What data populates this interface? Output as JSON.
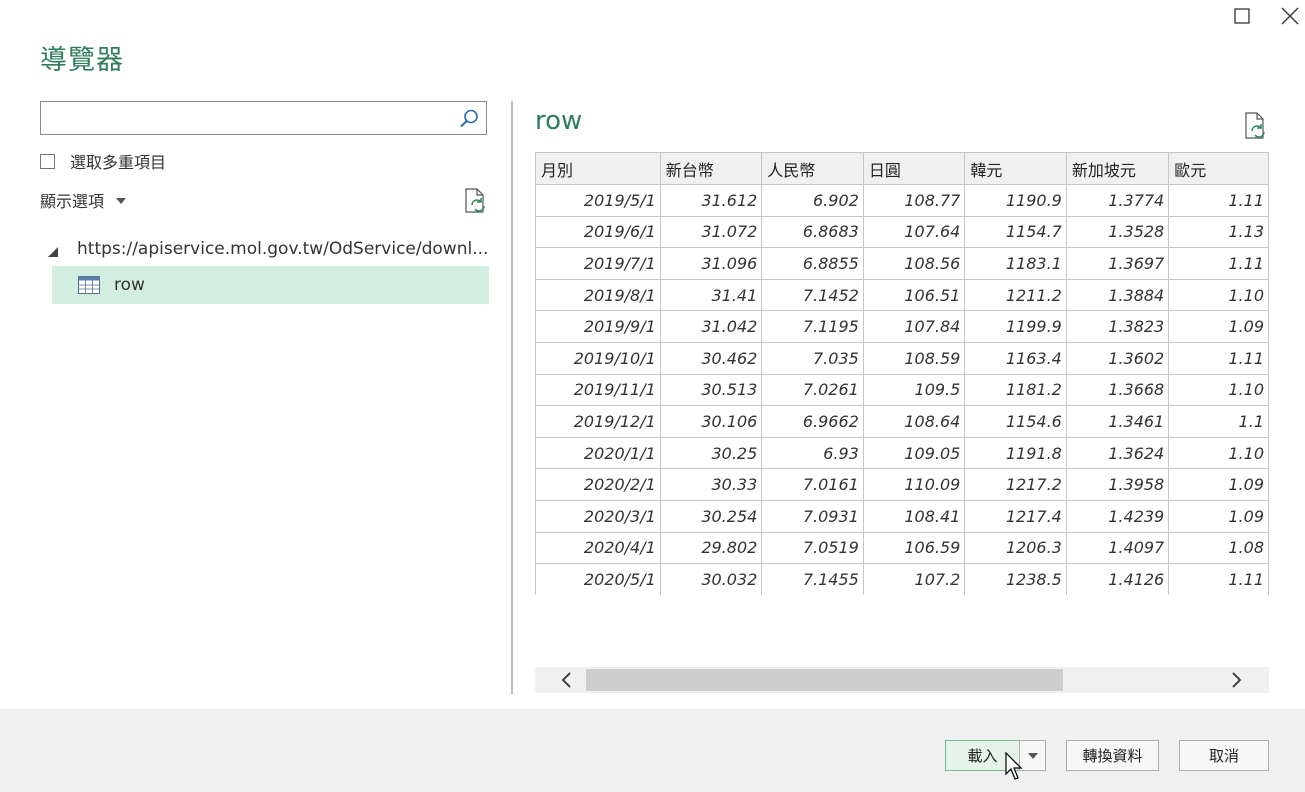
{
  "window": {
    "title": "導覽器",
    "maximize_icon": "maximize-icon",
    "close_icon": "close-icon"
  },
  "navigator": {
    "search": {
      "value": "",
      "placeholder": ""
    },
    "select_multiple_label": "選取多重項目",
    "display_options_label": "顯示選項",
    "tree": {
      "root_label": "https://apiservice.mol.gov.tw/OdService/downl...",
      "items": [
        {
          "label": "row",
          "selected": true
        }
      ]
    }
  },
  "preview": {
    "title": "row",
    "columns": [
      "月別",
      "新台幣",
      "人民幣",
      "日圓",
      "韓元",
      "新加坡元",
      "歐元"
    ],
    "rows": [
      [
        "2019/5/1",
        "31.612",
        "6.902",
        "108.77",
        "1190.9",
        "1.3774",
        "1.11"
      ],
      [
        "2019/6/1",
        "31.072",
        "6.8683",
        "107.64",
        "1154.7",
        "1.3528",
        "1.13"
      ],
      [
        "2019/7/1",
        "31.096",
        "6.8855",
        "108.56",
        "1183.1",
        "1.3697",
        "1.11"
      ],
      [
        "2019/8/1",
        "31.41",
        "7.1452",
        "106.51",
        "1211.2",
        "1.3884",
        "1.10"
      ],
      [
        "2019/9/1",
        "31.042",
        "7.1195",
        "107.84",
        "1199.9",
        "1.3823",
        "1.09"
      ],
      [
        "2019/10/1",
        "30.462",
        "7.035",
        "108.59",
        "1163.4",
        "1.3602",
        "1.11"
      ],
      [
        "2019/11/1",
        "30.513",
        "7.0261",
        "109.5",
        "1181.2",
        "1.3668",
        "1.10"
      ],
      [
        "2019/12/1",
        "30.106",
        "6.9662",
        "108.64",
        "1154.6",
        "1.3461",
        "1.1"
      ],
      [
        "2020/1/1",
        "30.25",
        "6.93",
        "109.05",
        "1191.8",
        "1.3624",
        "1.10"
      ],
      [
        "2020/2/1",
        "30.33",
        "7.0161",
        "110.09",
        "1217.2",
        "1.3958",
        "1.09"
      ],
      [
        "2020/3/1",
        "30.254",
        "7.0931",
        "108.41",
        "1217.4",
        "1.4239",
        "1.09"
      ],
      [
        "2020/4/1",
        "29.802",
        "7.0519",
        "106.59",
        "1206.3",
        "1.4097",
        "1.08"
      ],
      [
        "2020/5/1",
        "30.032",
        "7.1455",
        "107.2",
        "1238.5",
        "1.4126",
        "1.11"
      ]
    ]
  },
  "footer": {
    "load_label": "載入",
    "transform_label": "轉換資料",
    "cancel_label": "取消"
  },
  "colors": {
    "accent_green": "#2f7d5c",
    "selection": "#d1eee0",
    "folder": "#e8c07a",
    "footer_bg": "#f0f0f0"
  }
}
